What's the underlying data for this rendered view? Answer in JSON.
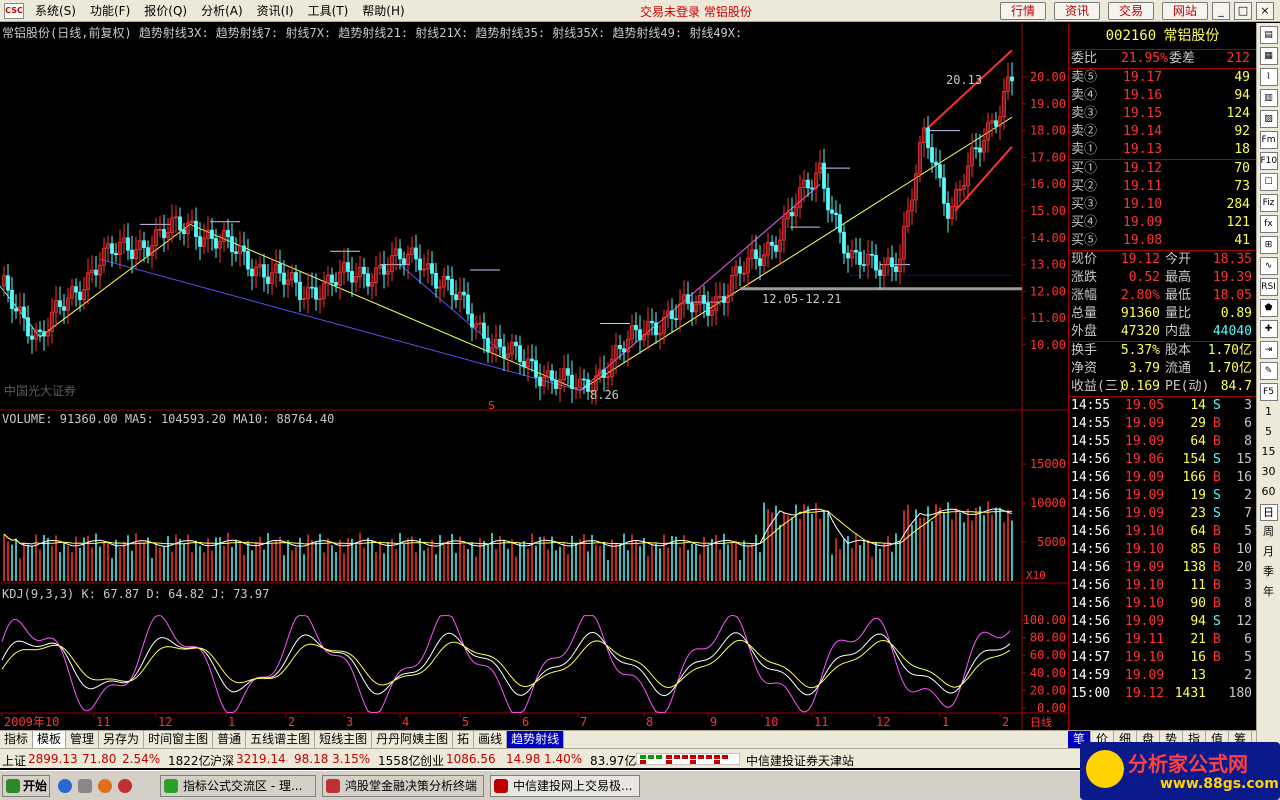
{
  "menubar": {
    "logo": "CSC",
    "menus": [
      "系统(S)",
      "功能(F)",
      "报价(Q)",
      "分析(A)",
      "资讯(I)",
      "工具(T)",
      "帮助(H)"
    ],
    "status": "交易未登录 常铝股份",
    "quick_buttons": [
      "行情",
      "资讯",
      "交易",
      "网站"
    ],
    "window_buttons": [
      "_",
      "□",
      "×"
    ]
  },
  "chart": {
    "header": "常铝股份(日线,前复权) 趋势射线3X: 趋势射线7: 射线7X: 趋势射线21: 射线21X: 趋势射线35: 射线35X: 趋势射线49: 射线49X:",
    "watermark": "中国光大证券",
    "price_axis": [
      "20.00",
      "19.00",
      "18.00",
      "17.00",
      "16.00",
      "15.00",
      "14.00",
      "13.00",
      "12.00",
      "11.00",
      "10.00"
    ],
    "high_label": "20.13",
    "low_label": "8.26",
    "range_label": "12.05-12.21",
    "s_marker": "S",
    "volume_header": "VOLUME: 91360.00 MA5: 104593.20 MA10: 88764.40",
    "volume_axis": [
      "15000",
      "10000",
      "5000"
    ],
    "volume_unit": "X10",
    "kdj_header": "KDJ(9,3,3) K: 67.87 D: 64.82 J: 73.97",
    "kdj_axis": [
      "100.00",
      "80.00",
      "60.00",
      "40.00",
      "20.00",
      "0.00"
    ],
    "date_axis": [
      "2009年10",
      "11",
      "12",
      "1",
      "2",
      "3",
      "4",
      "5",
      "6",
      "7",
      "8",
      "9",
      "10",
      "11",
      "12",
      "1",
      "2"
    ],
    "date_unit": "日线"
  },
  "chart_data": {
    "type": "line",
    "title": "常铝股份(日线,前复权)",
    "y_range": [
      10.0,
      20.0
    ],
    "series": [
      {
        "name": "price",
        "points": [
          [
            0,
            12.2
          ],
          [
            40,
            10.3
          ],
          [
            100,
            13.2
          ],
          [
            190,
            14.5
          ],
          [
            300,
            12.0
          ],
          [
            420,
            13.3
          ],
          [
            500,
            9.8
          ],
          [
            580,
            8.3
          ],
          [
            650,
            10.8
          ],
          [
            720,
            11.8
          ],
          [
            780,
            14.2
          ],
          [
            820,
            16.6
          ],
          [
            850,
            13.0
          ],
          [
            900,
            13.2
          ],
          [
            925,
            18.0
          ],
          [
            950,
            15.0
          ],
          [
            1000,
            19.0
          ],
          [
            1010,
            20.1
          ]
        ]
      },
      {
        "name": "VOLUME",
        "value": 91360.0
      },
      {
        "name": "MA5",
        "value": 104593.2
      },
      {
        "name": "MA10",
        "value": 88764.4
      },
      {
        "name": "K",
        "value": 67.87
      },
      {
        "name": "D",
        "value": 64.82
      },
      {
        "name": "J",
        "value": 73.97
      }
    ],
    "annotations": [
      "20.13",
      "8.26",
      "12.05-12.21"
    ]
  },
  "quote": {
    "code": "002160",
    "name": "常铝股份",
    "weibi_label": "委比",
    "weibi": "21.95%",
    "weicha_label": "委差",
    "weicha": "212",
    "asks": [
      {
        "label": "卖⑤",
        "price": "19.17",
        "vol": "49"
      },
      {
        "label": "卖④",
        "price": "19.16",
        "vol": "94"
      },
      {
        "label": "卖③",
        "price": "19.15",
        "vol": "124"
      },
      {
        "label": "卖②",
        "price": "19.14",
        "vol": "92"
      },
      {
        "label": "卖①",
        "price": "19.13",
        "vol": "18"
      }
    ],
    "bids": [
      {
        "label": "买①",
        "price": "19.12",
        "vol": "70"
      },
      {
        "label": "买②",
        "price": "19.11",
        "vol": "73"
      },
      {
        "label": "买③",
        "price": "19.10",
        "vol": "284"
      },
      {
        "label": "买④",
        "price": "19.09",
        "vol": "121"
      },
      {
        "label": "买⑤",
        "price": "19.08",
        "vol": "41"
      }
    ],
    "stats": [
      {
        "l1": "现价",
        "v1": "19.12",
        "l2": "今开",
        "v2": "18.35"
      },
      {
        "l1": "涨跌",
        "v1": "0.52",
        "l2": "最高",
        "v2": "19.39"
      },
      {
        "l1": "涨幅",
        "v1": "2.80%",
        "l2": "最低",
        "v2": "18.05"
      },
      {
        "l1": "总量",
        "v1": "91360",
        "l2": "量比",
        "v2": "0.89"
      },
      {
        "l1": "外盘",
        "v1": "47320",
        "l2": "内盘",
        "v2": "44040"
      }
    ],
    "stats2": [
      {
        "l1": "换手",
        "v1": "5.37%",
        "l2": "股本",
        "v2": "1.70亿"
      },
      {
        "l1": "净资",
        "v1": "3.79",
        "l2": "流通",
        "v2": "1.70亿"
      },
      {
        "l1": "收益(三)",
        "v1": "0.169",
        "l2": "PE(动)",
        "v2": "84.7"
      }
    ],
    "ticks": [
      {
        "t": "14:55",
        "p": "19.05",
        "v": "14",
        "s": "S",
        "n": "3"
      },
      {
        "t": "14:55",
        "p": "19.09",
        "v": "29",
        "s": "B",
        "n": "6"
      },
      {
        "t": "14:55",
        "p": "19.09",
        "v": "64",
        "s": "B",
        "n": "8"
      },
      {
        "t": "14:56",
        "p": "19.06",
        "v": "154",
        "s": "S",
        "n": "15"
      },
      {
        "t": "14:56",
        "p": "19.09",
        "v": "166",
        "s": "B",
        "n": "16"
      },
      {
        "t": "14:56",
        "p": "19.09",
        "v": "19",
        "s": "S",
        "n": "2"
      },
      {
        "t": "14:56",
        "p": "19.09",
        "v": "23",
        "s": "S",
        "n": "7"
      },
      {
        "t": "14:56",
        "p": "19.10",
        "v": "64",
        "s": "B",
        "n": "5"
      },
      {
        "t": "14:56",
        "p": "19.10",
        "v": "85",
        "s": "B",
        "n": "10"
      },
      {
        "t": "14:56",
        "p": "19.09",
        "v": "138",
        "s": "B",
        "n": "20"
      },
      {
        "t": "14:56",
        "p": "19.10",
        "v": "11",
        "s": "B",
        "n": "3"
      },
      {
        "t": "14:56",
        "p": "19.10",
        "v": "90",
        "s": "B",
        "n": "8"
      },
      {
        "t": "14:56",
        "p": "19.09",
        "v": "94",
        "s": "S",
        "n": "12"
      },
      {
        "t": "14:56",
        "p": "19.11",
        "v": "21",
        "s": "B",
        "n": "6"
      },
      {
        "t": "14:57",
        "p": "19.10",
        "v": "16",
        "s": "B",
        "n": "5"
      },
      {
        "t": "14:59",
        "p": "19.09",
        "v": "13",
        "s": "",
        "n": "2"
      },
      {
        "t": "15:00",
        "p": "19.12",
        "v": "1431",
        "s": "",
        "n": "180"
      }
    ]
  },
  "side_toolbar": [
    "▤",
    "▦",
    "⌇",
    "▥",
    "▨",
    "Fm",
    "F10",
    "☐",
    "Fiz",
    "fx",
    "⊞",
    "∿",
    "RSI",
    "⬟",
    "✚",
    "⇥",
    "✎",
    "F5",
    "1",
    "5",
    "15",
    "30",
    "60",
    "日",
    "周",
    "月",
    "季",
    "年"
  ],
  "tabbar": {
    "tabs": [
      "指标",
      "模板",
      "管理",
      "另存为",
      "时间窗主图",
      "普通",
      "五线谱主图",
      "短线主图",
      "丹丹阿姨主图",
      "拓",
      "画线",
      "趋势射线"
    ],
    "right_tabs": [
      "笔",
      "价",
      "细",
      "盘",
      "势",
      "指",
      "值",
      "筹"
    ]
  },
  "indexbar": {
    "sh_label": "上证",
    "sh_value": "2899.13",
    "sh_change": "71.80",
    "sh_pct": "2.54%",
    "sh_amount": "1822亿",
    "sz_label": "沪深",
    "sz_value": "3219.14",
    "sz_change": "98.18",
    "sz_pct": "3.15%",
    "sz_amount": "1558亿",
    "cy_label": "创业",
    "cy_value": "1086.56",
    "cy_change": "14.98",
    "cy_pct": "1.40%",
    "cy_amount": "83.97亿",
    "broker": "中信建投证券天津站"
  },
  "taskbar": {
    "start": "开始",
    "tasks": [
      "指标公式交流区 - 理...",
      "鸿股堂金融决策分析终端",
      "中信建投网上交易极..."
    ]
  },
  "watermark": {
    "main": "分析家公式网",
    "url": "www.88gs.com"
  },
  "colors": {
    "up": "#ff3232",
    "down": "#54fcfc",
    "yellow": "#ffff54",
    "magenta": "#ff54ff",
    "blue": "#5454ff",
    "axis": "#a00000"
  }
}
